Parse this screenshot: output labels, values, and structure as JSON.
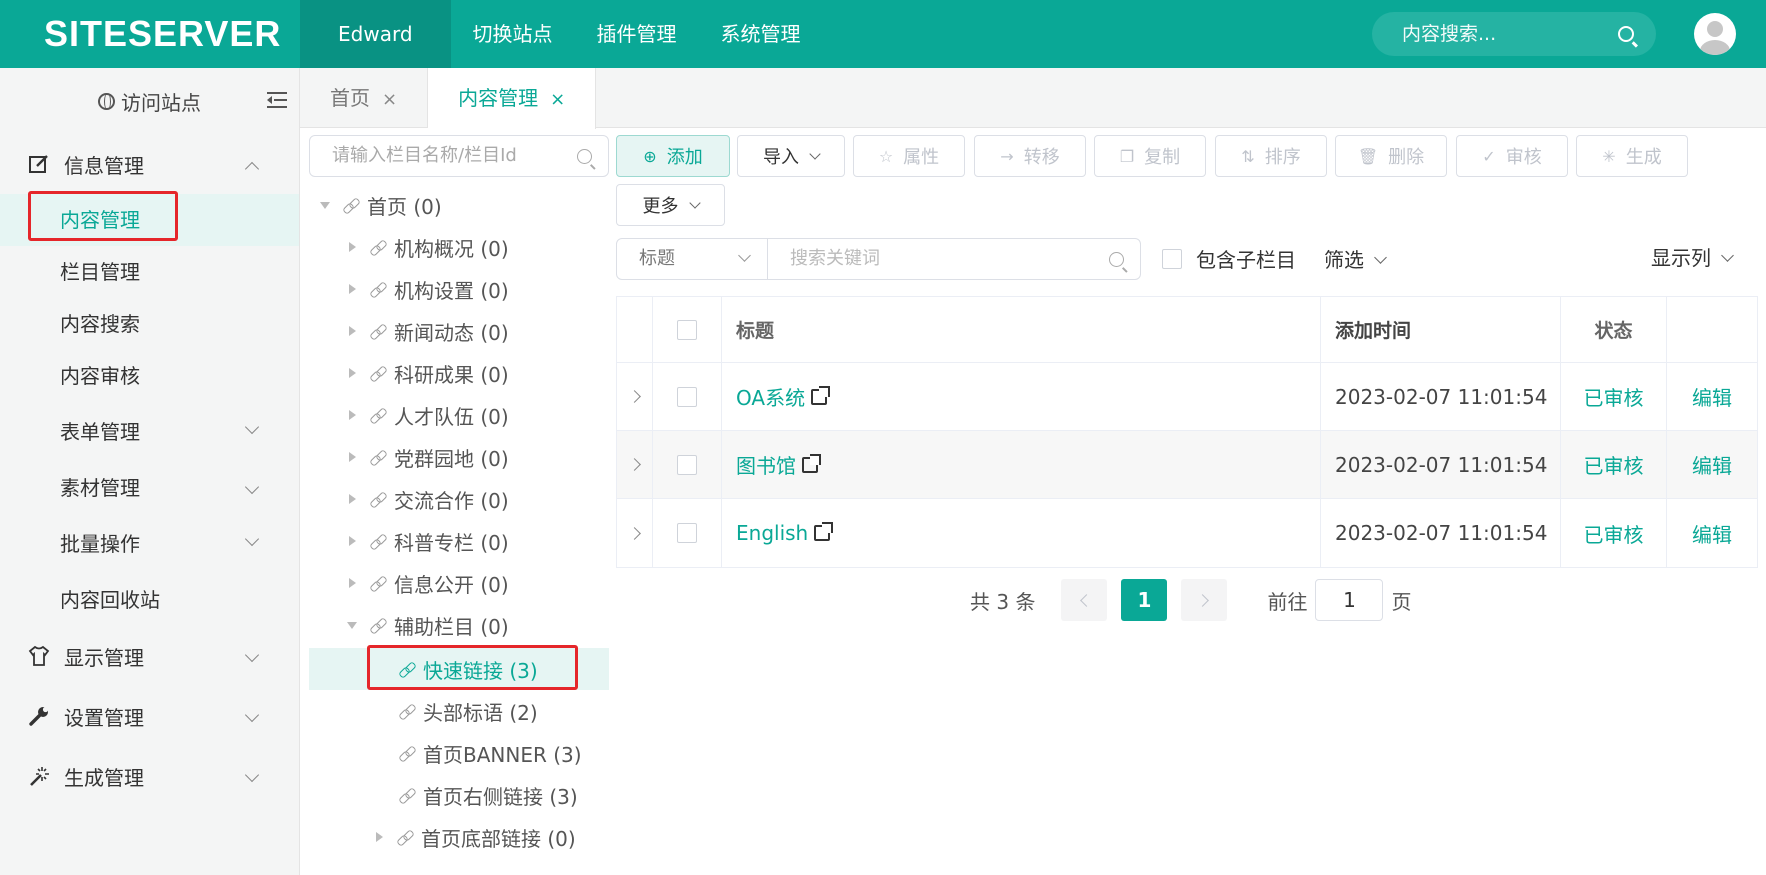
{
  "header": {
    "logo": "SITESERVER",
    "nav": [
      "Edward",
      "切换站点",
      "插件管理",
      "系统管理"
    ],
    "search_placeholder": "内容搜索..."
  },
  "sidebar": {
    "visit_site": "访问站点",
    "groups": {
      "info": "信息管理",
      "display": "显示管理",
      "settings": "设置管理",
      "generate": "生成管理"
    },
    "items": [
      "内容管理",
      "栏目管理",
      "内容搜索",
      "内容审核",
      "表单管理",
      "素材管理",
      "批量操作",
      "内容回收站"
    ]
  },
  "tabs": [
    {
      "label": "首页",
      "close": "×"
    },
    {
      "label": "内容管理",
      "close": "×"
    }
  ],
  "tree": {
    "search_placeholder": "请输入栏目名称/栏目Id",
    "nodes": [
      "首页 (0)",
      "机构概况 (0)",
      "机构设置 (0)",
      "新闻动态 (0)",
      "科研成果 (0)",
      "人才队伍 (0)",
      "党群园地 (0)",
      "交流合作 (0)",
      "科普专栏 (0)",
      "信息公开 (0)",
      "辅助栏目 (0)",
      "快速链接 (3)",
      "头部标语 (2)",
      "首页BANNER (3)",
      "首页右侧链接 (3)",
      "首页底部链接 (0)"
    ]
  },
  "toolbar": {
    "add": "添加",
    "import": "导入",
    "attr": "属性",
    "move": "转移",
    "copy": "复制",
    "sort": "排序",
    "delete": "删除",
    "audit": "审核",
    "generate": "生成",
    "more": "更多"
  },
  "filter": {
    "field": "标题",
    "keyword_placeholder": "搜索关键词",
    "include_sub": "包含子栏目",
    "filter": "筛选",
    "columns": "显示列"
  },
  "table": {
    "headers": {
      "title": "标题",
      "time": "添加时间",
      "status": "状态"
    },
    "rows": [
      {
        "title": "OA系统",
        "time": "2023-02-07 11:01:54",
        "status": "已审核",
        "edit": "编辑"
      },
      {
        "title": "图书馆",
        "time": "2023-02-07 11:01:54",
        "status": "已审核",
        "edit": "编辑"
      },
      {
        "title": "English",
        "time": "2023-02-07 11:01:54",
        "status": "已审核",
        "edit": "编辑"
      }
    ]
  },
  "pagination": {
    "total": "共 3 条",
    "current": "1",
    "goto": "前往",
    "goto_value": "1",
    "page_unit": "页"
  },
  "colors": {
    "accent": "#0aa896",
    "highlight_box": "#e5262a"
  }
}
